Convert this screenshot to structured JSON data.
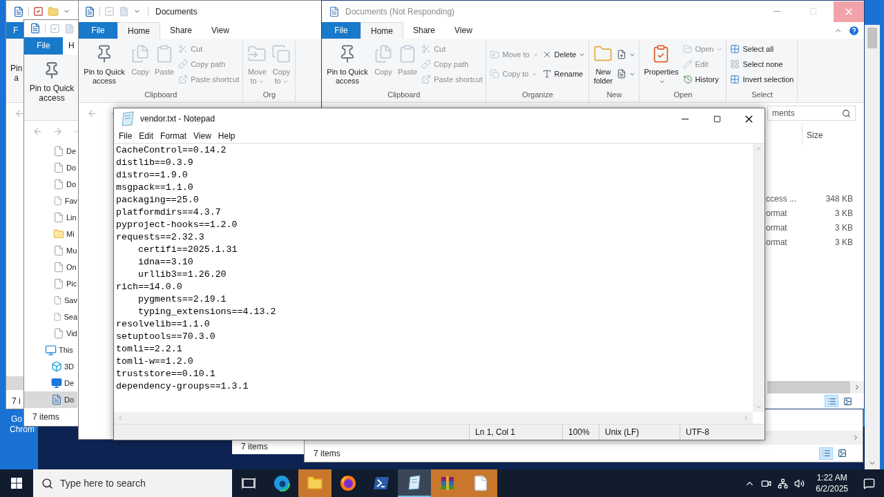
{
  "desktop_labels": [
    "Go",
    "Chrom"
  ],
  "explorer_back": {
    "file_tab": "F",
    "pin_lines": [
      "Pin",
      "a"
    ],
    "status": "7 i"
  },
  "explorer_left": {
    "file_tab": "File",
    "tab": "H",
    "pin": "Pin to Quick access",
    "nav": [
      {
        "label": "De",
        "kind": "file",
        "selected": false
      },
      {
        "label": "Do",
        "kind": "file",
        "selected": false
      },
      {
        "label": "Do",
        "kind": "file",
        "selected": false
      },
      {
        "label": "Fav",
        "kind": "file",
        "selected": false
      },
      {
        "label": "Lin",
        "kind": "file",
        "selected": false
      },
      {
        "label": "Mi",
        "kind": "folder",
        "selected": false
      },
      {
        "label": "Mu",
        "kind": "file",
        "selected": false
      },
      {
        "label": "On",
        "kind": "file",
        "selected": false
      },
      {
        "label": "Pic",
        "kind": "file",
        "selected": false
      },
      {
        "label": "Sav",
        "kind": "file",
        "selected": false
      },
      {
        "label": "Sea",
        "kind": "file",
        "selected": false
      },
      {
        "label": "Vid",
        "kind": "file",
        "selected": false
      },
      {
        "label": "This",
        "kind": "pc",
        "selected": false,
        "children": [
          {
            "label": "3D",
            "kind": "cube",
            "selected": false
          },
          {
            "label": "De",
            "kind": "desktop",
            "selected": false
          },
          {
            "label": "Do",
            "kind": "documents",
            "selected": true
          }
        ]
      }
    ],
    "status": "7 items"
  },
  "explorer_mid": {
    "title": "Documents",
    "file_tab": "File",
    "tabs": [
      {
        "label": "Home",
        "selected": true
      },
      {
        "label": "Share",
        "selected": false
      },
      {
        "label": "View",
        "selected": false
      }
    ],
    "ribbon": [
      {
        "label": "Clipboard",
        "columns": [
          [
            {
              "label": "Pin to Quick access",
              "kind": "pin",
              "disabled": false,
              "dropdown": false
            }
          ],
          [
            {
              "label": "Copy",
              "kind": "copy",
              "disabled": true,
              "dropdown": false
            }
          ],
          [
            {
              "label": "Paste",
              "kind": "paste",
              "disabled": true,
              "dropdown": false
            }
          ],
          [
            {
              "label": "Cut",
              "kind": "cut",
              "disabled": true,
              "dropdown": false
            },
            {
              "label": "Copy path",
              "kind": "copy-path",
              "disabled": true,
              "dropdown": false
            },
            {
              "label": "Paste shortcut",
              "kind": "paste-shortcut",
              "disabled": true,
              "dropdown": false
            }
          ]
        ]
      },
      {
        "label": "Org",
        "columns": [
          [
            {
              "label": "Move to",
              "kind": "move",
              "disabled": true,
              "dropdown": true
            }
          ],
          [
            {
              "label": "Copy to",
              "kind": "copy-to",
              "disabled": true,
              "dropdown": true
            }
          ]
        ]
      }
    ]
  },
  "explorer_small": {
    "status": "7 items"
  },
  "explorer_bottom": {
    "status": "7 items",
    "views": [
      {
        "kind": "details",
        "selected": true
      },
      {
        "kind": "tiles",
        "selected": false
      }
    ]
  },
  "explorer_main": {
    "title": "Documents (Not Responding)",
    "file_tab": "File",
    "tabs": [
      {
        "label": "Home",
        "selected": true
      },
      {
        "label": "Share",
        "selected": false
      },
      {
        "label": "View",
        "selected": false
      }
    ],
    "ribbon": [
      {
        "label": "Clipboard",
        "columns": [
          [
            {
              "label": "Pin to Quick access",
              "kind": "pin",
              "disabled": false,
              "dropdown": false
            }
          ],
          [
            {
              "label": "Copy",
              "kind": "copy",
              "disabled": true,
              "dropdown": false
            }
          ],
          [
            {
              "label": "Paste",
              "kind": "paste",
              "disabled": true,
              "dropdown": false
            }
          ],
          [
            {
              "label": "Cut",
              "kind": "cut",
              "disabled": true,
              "dropdown": false
            },
            {
              "label": "Copy path",
              "kind": "copy-path",
              "disabled": true,
              "dropdown": false
            },
            {
              "label": "Paste shortcut",
              "kind": "paste-shortcut",
              "disabled": true,
              "dropdown": false
            }
          ]
        ]
      },
      {
        "label": "Organize",
        "columns": [
          [
            {
              "label": "Move to",
              "kind": "move",
              "disabled": true,
              "dropdown": true
            },
            {
              "label": "Copy to",
              "kind": "copy-to",
              "disabled": true,
              "dropdown": true
            }
          ],
          [
            {
              "label": "Delete",
              "kind": "delete",
              "disabled": false,
              "dropdown": true
            },
            {
              "label": "Rename",
              "kind": "rename",
              "disabled": false,
              "dropdown": false
            }
          ]
        ]
      },
      {
        "label": "New",
        "columns": [
          [
            {
              "label": "New folder",
              "kind": "new-folder",
              "disabled": false,
              "dropdown": false
            }
          ],
          [
            {
              "kind": "new-item",
              "disabled": false,
              "dropdown": true
            },
            {
              "kind": "easy-access",
              "disabled": false,
              "dropdown": true
            }
          ]
        ]
      },
      {
        "label": "Open",
        "columns": [
          [
            {
              "label": "Properties",
              "kind": "properties",
              "disabled": false,
              "dropdown": true
            }
          ],
          [
            {
              "label": "Open",
              "kind": "open",
              "disabled": true,
              "dropdown": true
            },
            {
              "label": "Edit",
              "kind": "edit",
              "disabled": true,
              "dropdown": false
            },
            {
              "label": "History",
              "kind": "history",
              "disabled": false,
              "dropdown": false
            }
          ]
        ]
      },
      {
        "label": "Select",
        "columns": [
          [
            {
              "label": "Select all",
              "kind": "select-all",
              "disabled": false,
              "dropdown": false
            },
            {
              "label": "Select none",
              "kind": "select-none",
              "disabled": false,
              "dropdown": false
            },
            {
              "label": "Invert selection",
              "kind": "invert",
              "disabled": false,
              "dropdown": false
            }
          ]
        ]
      }
    ],
    "search_placeholder": "ments",
    "columns": [
      "Size"
    ],
    "rows": [
      {
        "type": "ccess ...",
        "size": "348 KB"
      },
      {
        "type": "ormat",
        "size": "3 KB"
      },
      {
        "type": "ormat",
        "size": "3 KB"
      },
      {
        "type": "ormat",
        "size": "3 KB"
      }
    ],
    "views": [
      {
        "kind": "details",
        "selected": true
      },
      {
        "kind": "tiles",
        "selected": false
      }
    ]
  },
  "notepad": {
    "title": "vendor.txt - Notepad",
    "menu": [
      "File",
      "Edit",
      "Format",
      "View",
      "Help"
    ],
    "lines": [
      "CacheControl==0.14.2",
      "distlib==0.3.9",
      "distro==1.9.0",
      "msgpack==1.1.0",
      "packaging==25.0",
      "platformdirs==4.3.7",
      "pyproject-hooks==1.2.0",
      "requests==2.32.3",
      "    certifi==2025.1.31",
      "    idna==3.10",
      "    urllib3==1.26.20",
      "rich==14.0.0",
      "    pygments==2.19.1",
      "    typing_extensions==4.13.2",
      "resolvelib==1.1.0",
      "setuptools==70.3.0",
      "tomli==2.2.1",
      "tomli-w==1.2.0",
      "truststore==0.10.1",
      "dependency-groups==1.3.1"
    ],
    "status": [
      "Ln 1, Col 1",
      "100%",
      "Unix (LF)",
      "UTF-8"
    ]
  },
  "taskbar": {
    "search_placeholder": "Type here to search",
    "apps": [
      {
        "kind": "task-view",
        "active": false,
        "flashing": false
      },
      {
        "kind": "edge",
        "active": false,
        "flashing": false
      },
      {
        "kind": "explorer",
        "active": false,
        "flashing": true
      },
      {
        "kind": "firefox",
        "active": false,
        "flashing": false
      },
      {
        "kind": "powershell",
        "active": false,
        "flashing": false
      },
      {
        "kind": "notepad",
        "active": true,
        "flashing": false
      },
      {
        "kind": "winrar",
        "active": false,
        "flashing": true
      },
      {
        "kind": "document",
        "active": false,
        "flashing": true
      }
    ],
    "time": "1:22 AM",
    "date": "6/2/2025"
  }
}
